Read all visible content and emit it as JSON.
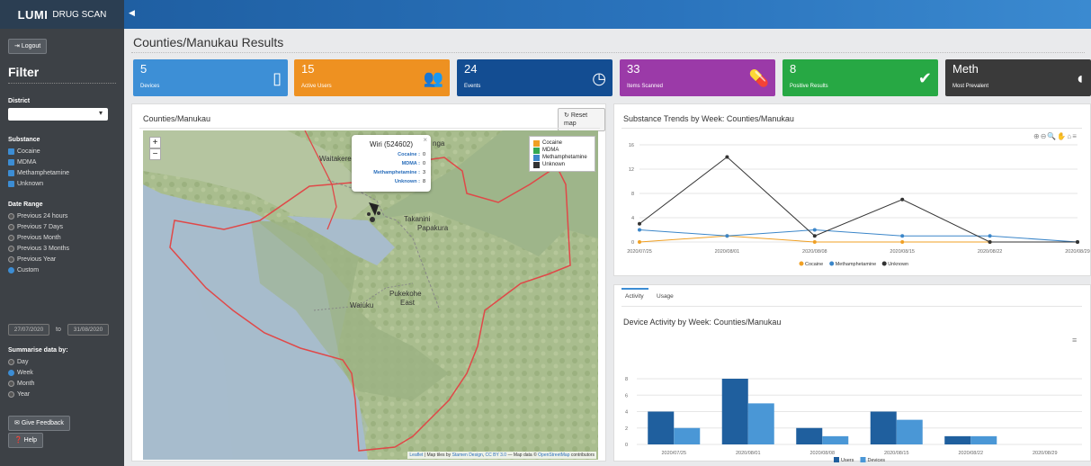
{
  "brand": {
    "name": "LUMI",
    "product": "DRUG SCAN"
  },
  "sidebar": {
    "logout_label": "Logout",
    "filter_title": "Filter",
    "district_label": "District",
    "district_value": "",
    "substance_label": "Substance",
    "substances": [
      {
        "label": "Cocaine",
        "checked": true
      },
      {
        "label": "MDMA",
        "checked": true
      },
      {
        "label": "Methamphetamine",
        "checked": true
      },
      {
        "label": "Unknown",
        "checked": true
      }
    ],
    "date_range_label": "Date Range",
    "date_ranges": [
      {
        "label": "Previous 24 hours",
        "checked": false
      },
      {
        "label": "Previous 7 Days",
        "checked": false
      },
      {
        "label": "Previous Month",
        "checked": false
      },
      {
        "label": "Previous 3 Months",
        "checked": false
      },
      {
        "label": "Previous Year",
        "checked": false
      },
      {
        "label": "Custom",
        "checked": true
      }
    ],
    "date_from": "27/07/2020",
    "date_to_label": "to",
    "date_to": "31/08/2020",
    "summarise_label": "Summarise data by:",
    "summarise": [
      {
        "label": "Day",
        "checked": false
      },
      {
        "label": "Week",
        "checked": true
      },
      {
        "label": "Month",
        "checked": false
      },
      {
        "label": "Year",
        "checked": false
      }
    ],
    "feedback_label": "Give Feedback",
    "help_label": "Help"
  },
  "page_title": "Counties/Manukau Results",
  "cards": [
    {
      "value": "5",
      "label": "Devices",
      "color": "#3d8fd6",
      "icon": "mobile-icon"
    },
    {
      "value": "15",
      "label": "Active Users",
      "color": "#ee9121",
      "icon": "users-icon"
    },
    {
      "value": "24",
      "label": "Events",
      "color": "#134d92",
      "icon": "clock-icon"
    },
    {
      "value": "33",
      "label": "Items Scanned",
      "color": "#9b3aa8",
      "icon": "pills-icon"
    },
    {
      "value": "8",
      "label": "Positive Results",
      "color": "#27a844",
      "icon": "check-circle-icon"
    },
    {
      "value": "Meth",
      "label": "Most Prevalent",
      "color": "#3a3a3a",
      "icon": "pills-dark-icon"
    }
  ],
  "map_panel": {
    "title": "Counties/Manukau",
    "reset_label": "Reset map",
    "zoom_in": "+",
    "zoom_out": "−",
    "popup": {
      "title": "Wiri (524602)",
      "rows": [
        {
          "label": "Cocaine :",
          "value": "0"
        },
        {
          "label": "MDMA :",
          "value": "0"
        },
        {
          "label": "Methamphetamine :",
          "value": "3"
        },
        {
          "label": "Unknown :",
          "value": "8"
        }
      ],
      "close": "×"
    },
    "legend": [
      {
        "label": "Cocaine",
        "color": "#f0a024"
      },
      {
        "label": "MDMA",
        "color": "#34a853"
      },
      {
        "label": "Methamphetamine",
        "color": "#3b86c9"
      },
      {
        "label": "Unknown",
        "color": "#333333"
      }
    ],
    "place_labels": [
      "Waitakere",
      "Takanini",
      "Papakura",
      "Waiuku",
      "Pukekohe",
      "East",
      "nga"
    ],
    "attribution": {
      "leaflet": "Leaflet",
      "text1": " | Map tiles by ",
      "stamen": "Stamen Design",
      "sep": ", ",
      "cc": "CC BY 3.0",
      "text2": " — Map data © ",
      "osm": "OpenStreetMap",
      "text3": " contributors"
    }
  },
  "trend_panel": {
    "title": "Substance Trends by Week: Counties/Manukau",
    "toolbar_icons": [
      "zoom-in-icon",
      "zoom-out-icon",
      "search-zoom-icon",
      "pan-hand-icon",
      "home-icon",
      "menu-icon"
    ]
  },
  "activity_panel": {
    "tabs": [
      {
        "label": "Activity",
        "active": true
      },
      {
        "label": "Usage",
        "active": false
      }
    ],
    "title": "Device Activity by Week: Counties/Manukau"
  },
  "chart_data": [
    {
      "type": "line",
      "title": "Substance Trends by Week: Counties/Manukau",
      "x": [
        "2020/07/25",
        "2020/08/01",
        "2020/08/08",
        "2020/08/15",
        "2020/08/22",
        "2020/08/29"
      ],
      "series": [
        {
          "name": "Cocaine",
          "color": "#f0a024",
          "values": [
            0,
            1,
            0,
            0,
            0,
            0
          ]
        },
        {
          "name": "Methamphetamine",
          "color": "#3b86c9",
          "values": [
            2,
            1,
            2,
            1,
            1,
            0
          ]
        },
        {
          "name": "Unknown",
          "color": "#333333",
          "values": [
            3,
            14,
            1,
            7,
            0,
            0
          ]
        }
      ],
      "yticks": [
        0,
        4,
        8,
        12,
        16
      ],
      "ylim": [
        0,
        16
      ],
      "grid": true,
      "legend": "bottom"
    },
    {
      "type": "bar",
      "title": "Device Activity by Week: Counties/Manukau",
      "categories": [
        "2020/07/25",
        "2020/08/01",
        "2020/08/08",
        "2020/08/15",
        "2020/08/22",
        "2020/08/29"
      ],
      "series": [
        {
          "name": "Users",
          "color": "#1f5f9e",
          "values": [
            4,
            8,
            2,
            4,
            1,
            0
          ]
        },
        {
          "name": "Devices",
          "color": "#4a97d6",
          "values": [
            2,
            5,
            1,
            3,
            1,
            0
          ]
        }
      ],
      "yticks": [
        0,
        2,
        4,
        6,
        8
      ],
      "ylim": [
        0,
        8
      ],
      "grid": true,
      "legend": "bottom"
    }
  ]
}
